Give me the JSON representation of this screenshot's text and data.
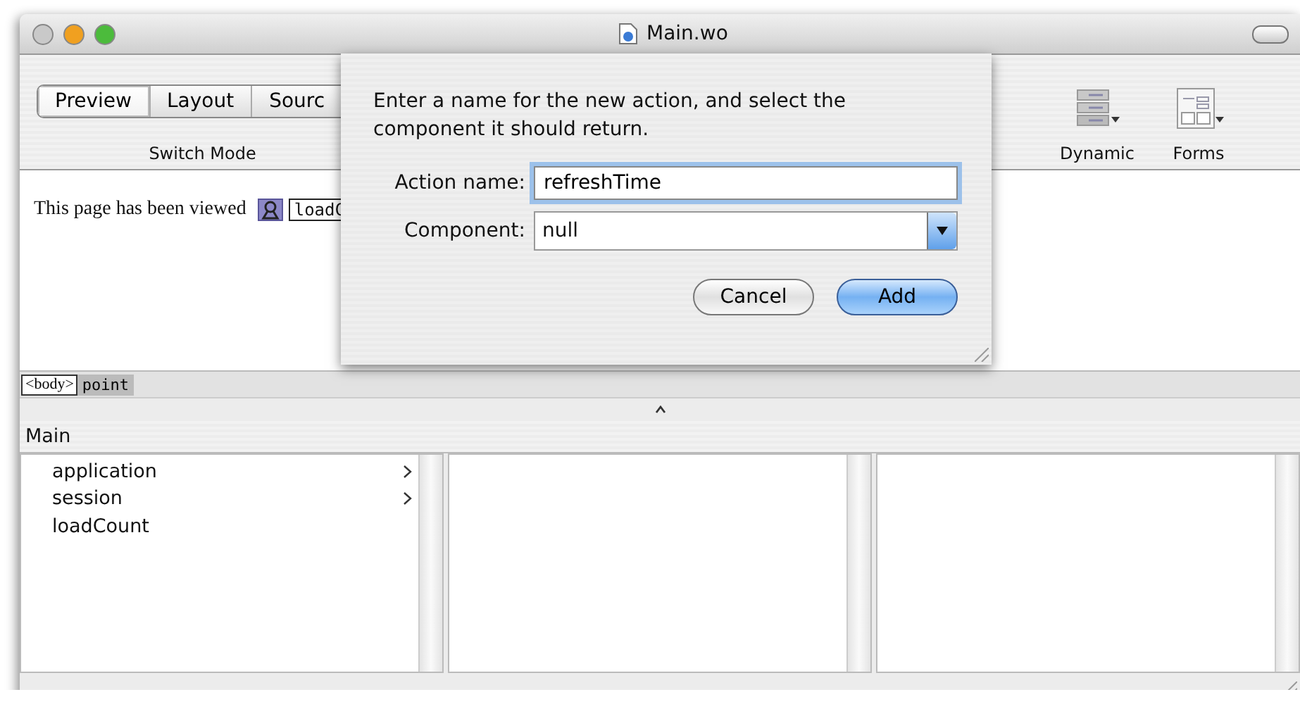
{
  "window": {
    "title": "Main.wo"
  },
  "toolbar": {
    "modes": [
      {
        "label": "Preview",
        "selected": true
      },
      {
        "label": "Layout",
        "selected": false
      },
      {
        "label": "Sourc",
        "selected": false
      }
    ],
    "mode_caption": "Switch Mode",
    "items": [
      {
        "label": "Dynamic",
        "kind": "dynamic"
      },
      {
        "label": "Forms",
        "kind": "forms"
      }
    ]
  },
  "page_content": {
    "text": "This page has been viewed",
    "binding": "loadC"
  },
  "path_bar": [
    {
      "label": "<body>",
      "selected": false
    },
    {
      "label": "point",
      "selected": true
    }
  ],
  "browser": {
    "title": "Main",
    "items": [
      {
        "label": "application",
        "has_children": true
      },
      {
        "label": "session",
        "has_children": true
      },
      {
        "label": "loadCount",
        "has_children": false
      }
    ]
  },
  "sheet": {
    "message": "Enter a name for the new action, and select the component it should return.",
    "fields": [
      {
        "label": "Action name:",
        "value": "refreshTime",
        "kind": "text",
        "focused": true
      },
      {
        "label": "Component:",
        "value": "null",
        "kind": "popup",
        "focused": false
      }
    ],
    "buttons": [
      {
        "label": "Cancel",
        "default": false
      },
      {
        "label": "Add",
        "default": true
      }
    ]
  }
}
